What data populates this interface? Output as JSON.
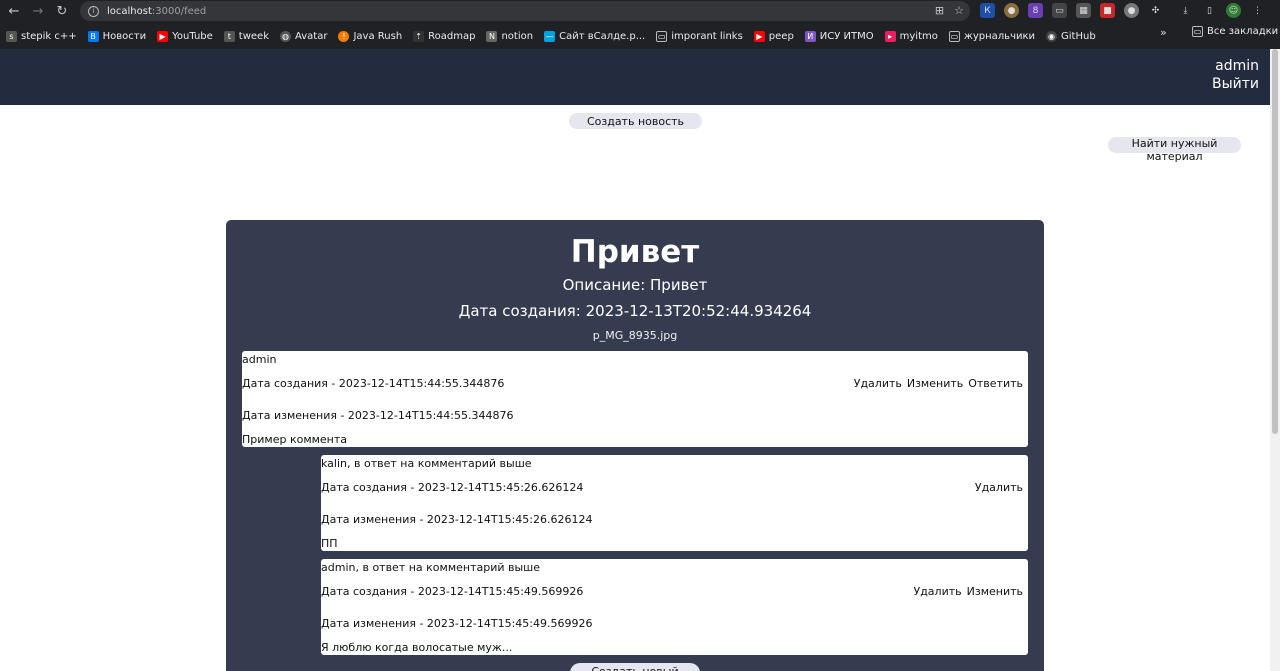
{
  "browser": {
    "url_host": "localhost",
    "url_path": ":3000/feed",
    "bookmarks": [
      {
        "label": "stepik c++",
        "icon": "stepik-icon",
        "color": "#5f6368"
      },
      {
        "label": "Новости",
        "icon": "vk-icon",
        "color": "#0077ff"
      },
      {
        "label": "YouTube",
        "icon": "youtube-icon",
        "color": "#ff0000"
      },
      {
        "label": "tweek",
        "icon": "tweek-icon",
        "color": "#5f6368"
      },
      {
        "label": "Avatar",
        "icon": "globe-icon",
        "color": "#5f6368"
      },
      {
        "label": "Java Rush",
        "icon": "javarush-icon",
        "color": "#f57c00"
      },
      {
        "label": "Roadmap",
        "icon": "roadmap-icon",
        "color": "#5f6368"
      },
      {
        "label": "notion",
        "icon": "notion-icon",
        "color": "#5f6368"
      },
      {
        "label": "Сайт вСалде.р...",
        "icon": "site-icon",
        "color": "#00a1e0"
      },
      {
        "label": "imporant links",
        "icon": "folder-icon",
        "color": "#5f6368"
      },
      {
        "label": "peep",
        "icon": "youtube-icon",
        "color": "#ff0000"
      },
      {
        "label": "ИСУ ИТМО",
        "icon": "itmo-icon",
        "color": "#7e57c2"
      },
      {
        "label": "myitmo",
        "icon": "myitmo-icon",
        "color": "#e91e63"
      },
      {
        "label": "журнальчики",
        "icon": "folder-icon",
        "color": "#5f6368"
      },
      {
        "label": "GitHub",
        "icon": "github-icon",
        "color": "#5f6368"
      }
    ],
    "all_bookmarks": "Все закладки"
  },
  "header": {
    "username": "admin",
    "logout": "Выйти"
  },
  "actions": {
    "create_news": "Создать новость",
    "find_material": "Найти нужный материал",
    "create_comment": "Создать новый"
  },
  "news": {
    "title": "Привет",
    "description": "Описание: Привет",
    "created": "Дата создания: 2023-12-13T20:52:44.934264",
    "file": "p_MG_8935.jpg"
  },
  "comments": [
    {
      "author": "admin",
      "created": "Дата создания - 2023-12-14T15:44:55.344876",
      "modified": "Дата изменения - 2023-12-14T15:44:55.344876",
      "text": "Пример коммента",
      "actions": [
        "Удалить",
        "Изменить",
        "Ответить"
      ]
    },
    {
      "author": "kalin, в ответ на комментарий выше",
      "created": "Дата создания - 2023-12-14T15:45:26.626124",
      "modified": "Дата изменения - 2023-12-14T15:45:26.626124",
      "text": "ПП",
      "actions": [
        "Удалить"
      ]
    },
    {
      "author": "admin, в ответ на комментарий выше",
      "created": "Дата создания - 2023-12-14T15:45:49.569926",
      "modified": "Дата изменения - 2023-12-14T15:45:49.569926",
      "text": "Я люблю когда волосатые муж...",
      "actions": [
        "Удалить",
        "Изменить"
      ]
    }
  ]
}
